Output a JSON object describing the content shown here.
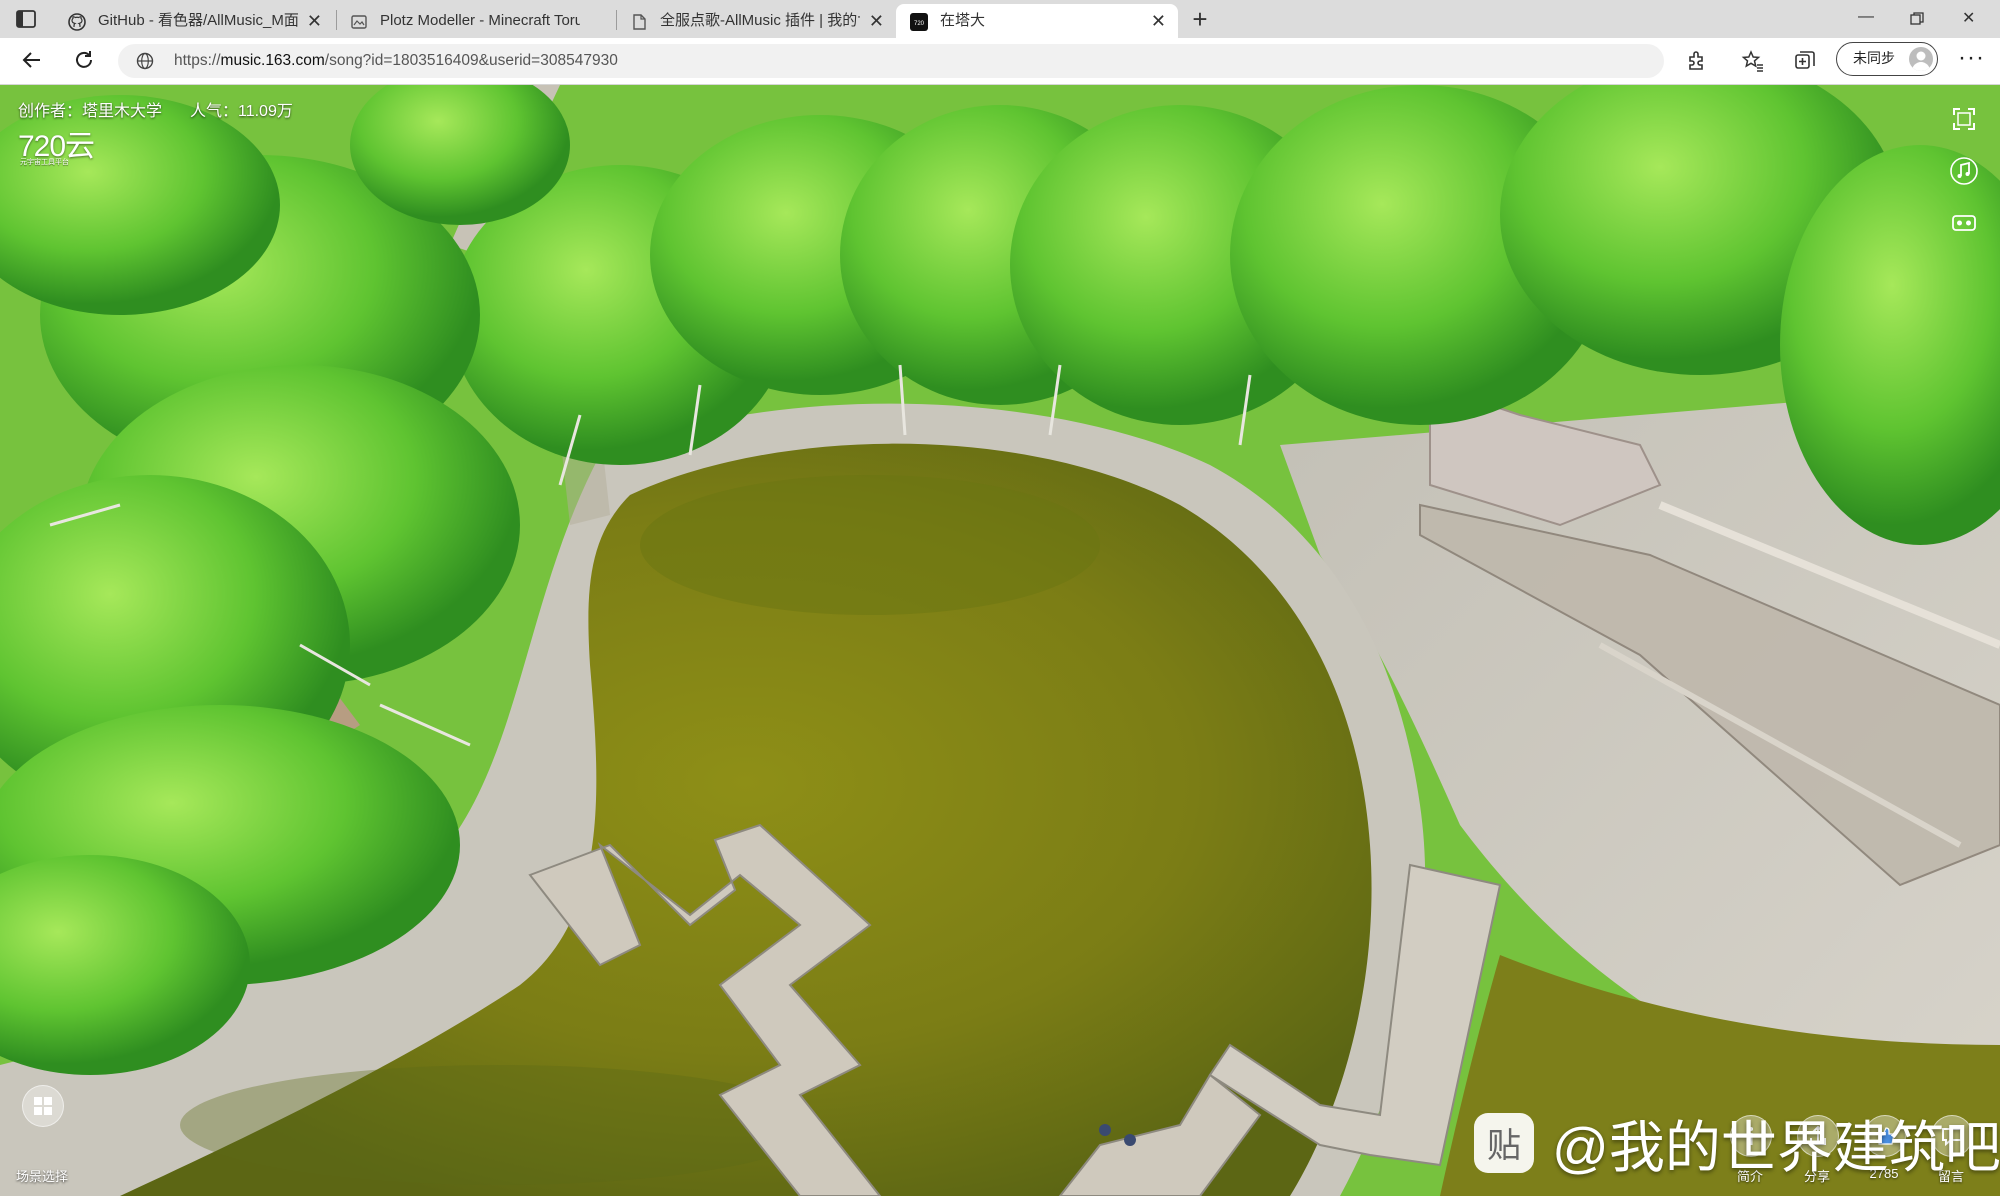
{
  "browser": {
    "tabs": [
      {
        "title": "GitHub - 看色器/AllMusic_M面庫",
        "active": false
      },
      {
        "title": "Plotz Modeller - Minecraft Torus",
        "active": false
      },
      {
        "title": "全服点歌-AllMusic 插件 | 我的世",
        "active": false
      },
      {
        "title": "在塔大",
        "active": true
      }
    ],
    "address": {
      "url_prefix": "https://",
      "url_host": "music.163.com",
      "url_path": "/song?id=1803516409&userid=308547930"
    },
    "sync_label": "未同步"
  },
  "panorama": {
    "creator": "创作者：塔里木大学",
    "popularity": "人气：11.09万",
    "logo": "720云",
    "logo_sub": "元宇宙工具平台",
    "scene_select_label": "场景选择",
    "buttons": [
      {
        "icon": "info-icon",
        "label": "简介"
      },
      {
        "icon": "share-icon",
        "label": "分享"
      },
      {
        "icon": "like-icon",
        "label": "2785"
      },
      {
        "icon": "comment-icon",
        "label": "留言"
      }
    ],
    "watermark_text": "@我的世界建筑吧"
  }
}
